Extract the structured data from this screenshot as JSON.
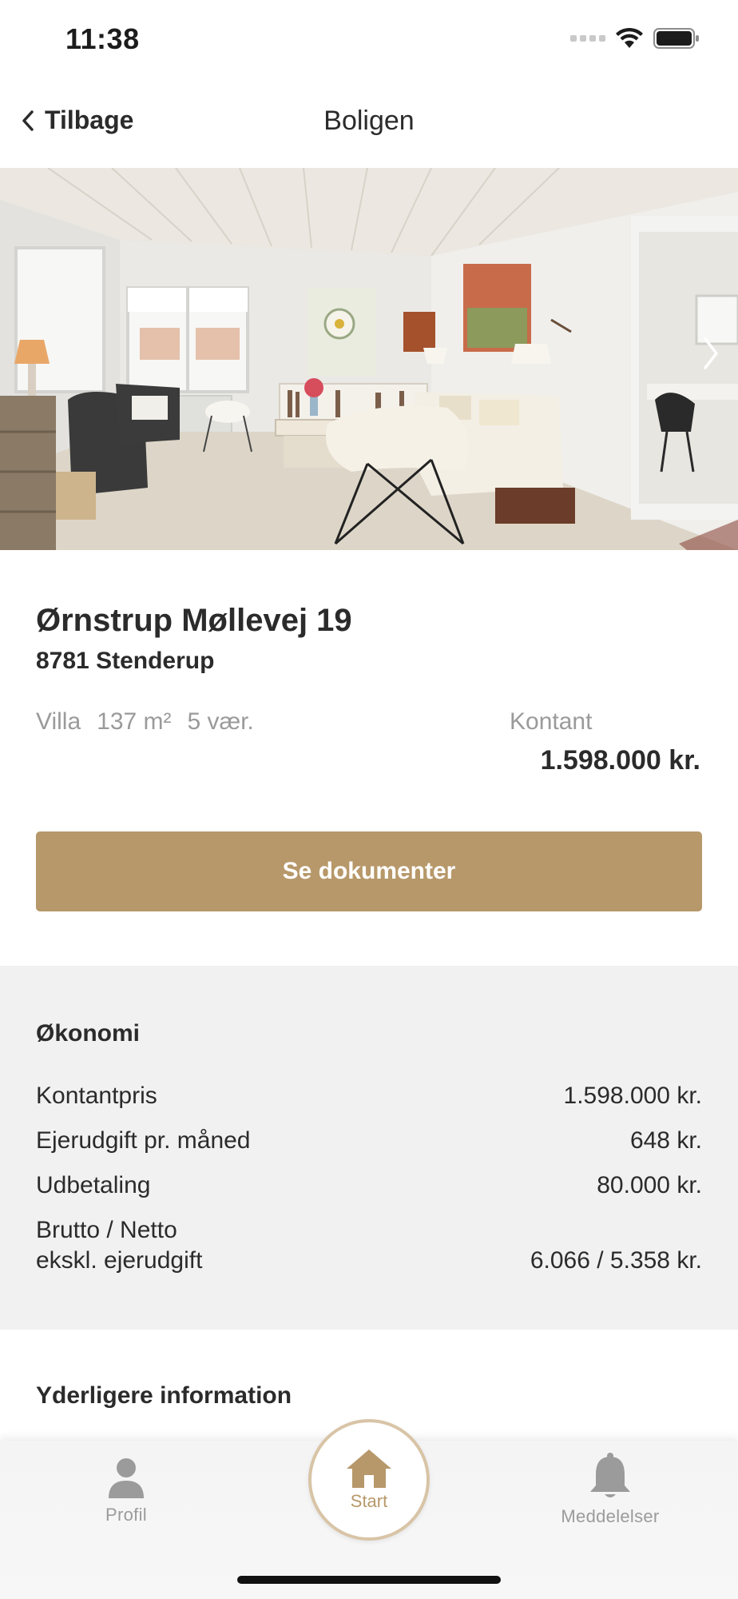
{
  "status": {
    "time": "11:38"
  },
  "nav": {
    "back_label": "Tilbage",
    "title": "Boligen"
  },
  "property": {
    "address": "Ørnstrup Møllevej 19",
    "city": "8781 Stenderup",
    "type": "Villa",
    "area": "137 m²",
    "rooms": "5 vær.",
    "price_label": "Kontant",
    "price": "1.598.000 kr.",
    "docs_button": "Se dokumenter"
  },
  "economy": {
    "title": "Økonomi",
    "rows": [
      {
        "label": "Kontantpris",
        "value": "1.598.000 kr."
      },
      {
        "label": "Ejerudgift pr. måned",
        "value": "648 kr."
      },
      {
        "label": "Udbetaling",
        "value": "80.000 kr."
      },
      {
        "label": "Brutto / Netto\nekskl. ejerudgift",
        "value": "6.066 / 5.358 kr."
      }
    ]
  },
  "more_info": {
    "title": "Yderligere information"
  },
  "tabs": [
    {
      "label": "Profil",
      "icon": "person-icon"
    },
    {
      "label": "Start",
      "icon": "home-icon"
    },
    {
      "label": "Meddelelser",
      "icon": "bell-icon"
    }
  ],
  "colors": {
    "accent": "#b7986a",
    "accent_light": "#d8c4a6",
    "section_bg": "#f1f1f1",
    "muted": "#9a9a9a"
  }
}
